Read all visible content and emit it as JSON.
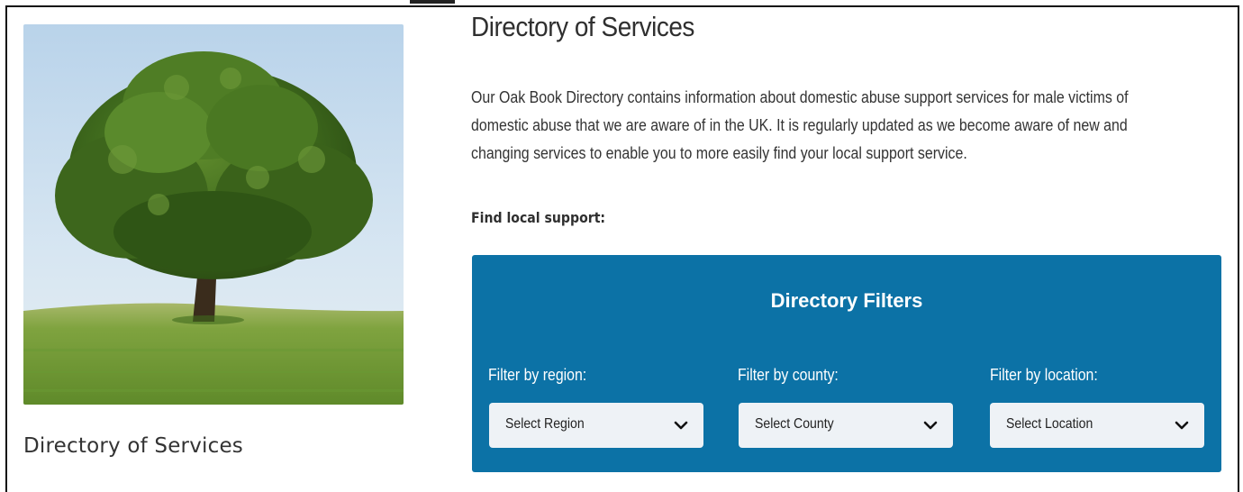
{
  "sidebar": {
    "title": "Directory of Services"
  },
  "main": {
    "title": "Directory of Services",
    "intro_lines": [
      "Our Oak Book Directory contains information about domestic abuse support services for male victims of",
      "domestic abuse that we are aware of in the UK. It is regularly updated as we become aware of new and",
      "changing services to enable you to more easily find your local support service."
    ],
    "find_label": "Find local support:"
  },
  "filters": {
    "title": "Directory Filters",
    "region_label": "Filter by region:",
    "region_value": "Select Region",
    "county_label": "Filter by county:",
    "county_value": "Select County",
    "location_label": "Filter by location:",
    "location_value": "Select Location"
  },
  "colors": {
    "panel": "#0c72a6",
    "select_bg": "#eef2f6",
    "text": "#333333"
  },
  "icons": {
    "hero": "oak-tree-photo",
    "dropdown": "chevron-down-icon"
  }
}
